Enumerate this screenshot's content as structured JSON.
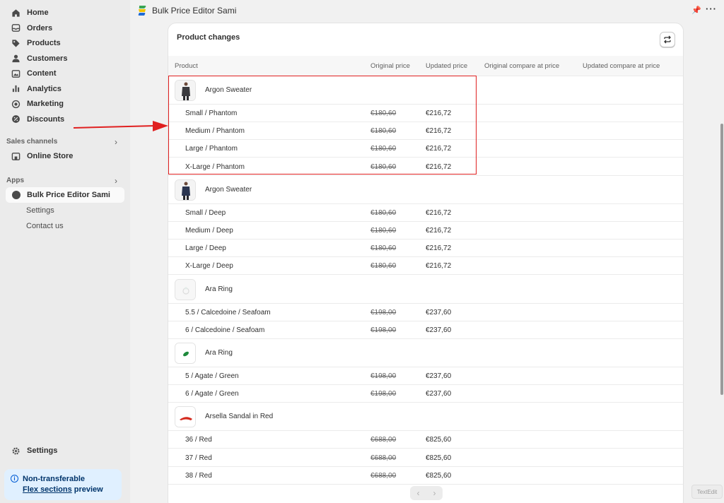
{
  "sidebar": {
    "nav": [
      {
        "label": "Home",
        "icon": "home-icon"
      },
      {
        "label": "Orders",
        "icon": "inbox-icon"
      },
      {
        "label": "Products",
        "icon": "tag-icon"
      },
      {
        "label": "Customers",
        "icon": "person-icon"
      },
      {
        "label": "Content",
        "icon": "image-icon"
      },
      {
        "label": "Analytics",
        "icon": "bar-chart-icon"
      },
      {
        "label": "Marketing",
        "icon": "target-icon"
      },
      {
        "label": "Discounts",
        "icon": "discount-icon"
      }
    ],
    "sales_channels_label": "Sales channels",
    "online_store_label": "Online Store",
    "apps_label": "Apps",
    "app_name": "Bulk Price Editor Sami",
    "app_sub": [
      "Settings",
      "Contact us"
    ],
    "settings_label": "Settings",
    "notice": {
      "line1": "Non-transferable",
      "link": "Flex sections",
      "tail": " preview"
    }
  },
  "topbar": {
    "title": "Bulk Price Editor Sami"
  },
  "card": {
    "title": "Product changes",
    "columns": [
      "Product",
      "Original price",
      "Updated price",
      "Original compare at price",
      "Updated compare at price"
    ],
    "groups": [
      {
        "name": "Argon Sweater",
        "thumb": "sweater-dark",
        "variants": [
          {
            "name": "Small / Phantom",
            "orig": "€180,60",
            "upd": "€216,72"
          },
          {
            "name": "Medium / Phantom",
            "orig": "€180,60",
            "upd": "€216,72"
          },
          {
            "name": "Large / Phantom",
            "orig": "€180,60",
            "upd": "€216,72"
          },
          {
            "name": "X-Large / Phantom",
            "orig": "€180,60",
            "upd": "€216,72"
          }
        ]
      },
      {
        "name": "Argon Sweater",
        "thumb": "sweater-navy",
        "variants": [
          {
            "name": "Small / Deep",
            "orig": "€180,60",
            "upd": "€216,72"
          },
          {
            "name": "Medium / Deep",
            "orig": "€180,60",
            "upd": "€216,72"
          },
          {
            "name": "Large / Deep",
            "orig": "€180,60",
            "upd": "€216,72"
          },
          {
            "name": "X-Large / Deep",
            "orig": "€180,60",
            "upd": "€216,72"
          }
        ]
      },
      {
        "name": "Ara Ring",
        "thumb": "ring-seafoam",
        "variants": [
          {
            "name": "5.5 / Calcedoine / Seafoam",
            "orig": "€198,00",
            "upd": "€237,60"
          },
          {
            "name": "6 / Calcedoine / Seafoam",
            "orig": "€198,00",
            "upd": "€237,60"
          }
        ]
      },
      {
        "name": "Ara Ring",
        "thumb": "ring-green",
        "variants": [
          {
            "name": "5 / Agate / Green",
            "orig": "€198,00",
            "upd": "€237,60"
          },
          {
            "name": "6 / Agate / Green",
            "orig": "€198,00",
            "upd": "€237,60"
          }
        ]
      },
      {
        "name": "Arsella Sandal in Red",
        "thumb": "sandal-red",
        "variants": [
          {
            "name": "36 / Red",
            "orig": "€688,00",
            "upd": "€825,60"
          },
          {
            "name": "37 / Red",
            "orig": "€688,00",
            "upd": "€825,60"
          },
          {
            "name": "38 / Red",
            "orig": "€688,00",
            "upd": "€825,60"
          }
        ]
      }
    ]
  },
  "textedit_label": "TextEdit",
  "colors": {
    "highlight": "#e02020",
    "accent": "#005bd3"
  }
}
